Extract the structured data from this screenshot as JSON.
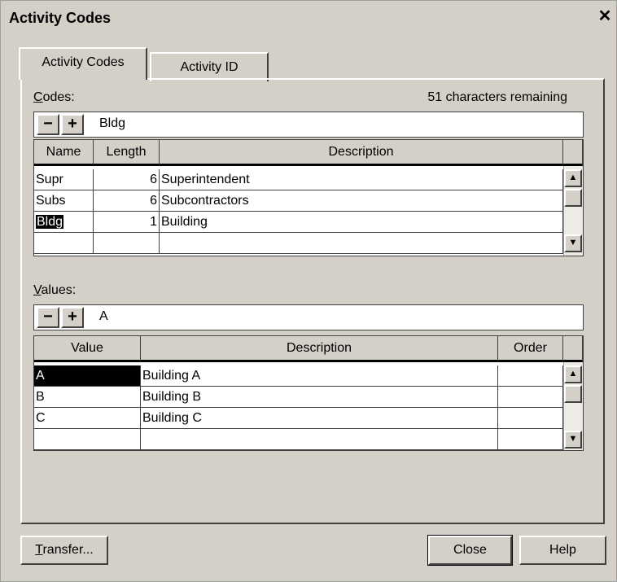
{
  "window": {
    "title": "Activity Codes",
    "close_glyph": "✕"
  },
  "tabs": [
    {
      "label": "Activity Codes"
    },
    {
      "label": "Activity ID"
    }
  ],
  "codes": {
    "label_first": "C",
    "label_rest": "odes:",
    "remaining": "51 characters remaining",
    "edit_value": "Bldg",
    "minus": "−",
    "plus": "+",
    "headers": {
      "name": "Name",
      "length": "Length",
      "description": "Description"
    },
    "rows": [
      {
        "name": "Supr",
        "length": "6",
        "description": "Superintendent"
      },
      {
        "name": "Subs",
        "length": "6",
        "description": "Subcontractors"
      },
      {
        "name": "Bldg",
        "length": "1",
        "description": "Building"
      },
      {
        "name": "",
        "length": "",
        "description": ""
      }
    ]
  },
  "values": {
    "label_first": "V",
    "label_rest": "alues:",
    "edit_value": "A",
    "minus": "−",
    "plus": "+",
    "headers": {
      "value": "Value",
      "description": "Description",
      "order": "Order"
    },
    "rows": [
      {
        "value": "A",
        "description": "Building A",
        "order": ""
      },
      {
        "value": "B",
        "description": "Building B",
        "order": ""
      },
      {
        "value": "C",
        "description": "Building C",
        "order": ""
      },
      {
        "value": "",
        "description": "",
        "order": ""
      }
    ]
  },
  "scroll": {
    "up": "▲",
    "down": "▼"
  },
  "buttons": {
    "transfer_first": "T",
    "transfer_rest": "ransfer...",
    "close": "Close",
    "help": "Help"
  }
}
